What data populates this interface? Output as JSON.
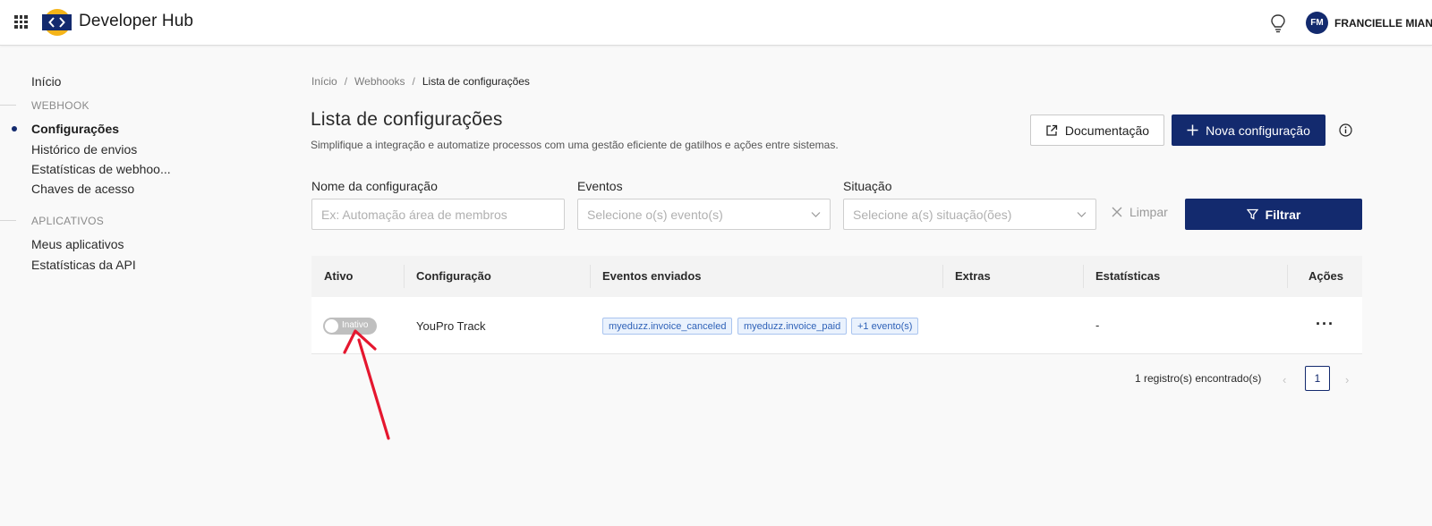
{
  "header": {
    "app_title": "Developer Hub",
    "avatar_initials": "FM",
    "user_name": "FRANCIELLE MIANE"
  },
  "sidebar": {
    "home": "Início",
    "webhook_section": "WEBHOOK",
    "webhook_items": [
      "Configurações",
      "Histórico de envios",
      "Estatísticas de webhoo..."
    ],
    "keys": "Chaves de acesso",
    "apps_section": "APLICATIVOS",
    "apps_items": [
      "Meus aplicativos",
      "Estatísticas da API"
    ]
  },
  "breadcrumb": [
    "Início",
    "Webhooks",
    "Lista de configurações"
  ],
  "page": {
    "title": "Lista de configurações",
    "subtitle": "Simplifique a integração e automatize processos com uma gestão eficiente de gatilhos e ações entre sistemas.",
    "doc_button": "Documentação",
    "new_button": "Nova configuração"
  },
  "filters": {
    "name_label": "Nome da configuração",
    "name_placeholder": "Ex: Automação área de membros",
    "events_label": "Eventos",
    "events_placeholder": "Selecione o(s) evento(s)",
    "status_label": "Situação",
    "status_placeholder": "Selecione a(s) situação(ões)",
    "clear_button": "Limpar",
    "filter_button": "Filtrar"
  },
  "table": {
    "headers": [
      "Ativo",
      "Configuração",
      "Eventos enviados",
      "Extras",
      "Estatísticas",
      "Ações"
    ],
    "rows": [
      {
        "active_label": "Inativo",
        "active": false,
        "name": "YouPro Track",
        "events": [
          "myeduzz.invoice_canceled",
          "myeduzz.invoice_paid",
          "+1 evento(s)"
        ],
        "extras": "",
        "stats": "-",
        "actions": "···"
      }
    ]
  },
  "pagination": {
    "count_text": "1 registro(s) encontrado(s)",
    "current_page": "1",
    "prev": "‹",
    "next": "›"
  },
  "colors": {
    "brand": "#132a6e",
    "annotation_arrow": "#e5172f",
    "tag_bg": "#eaf2fd",
    "tag_text": "#2f62b8"
  }
}
